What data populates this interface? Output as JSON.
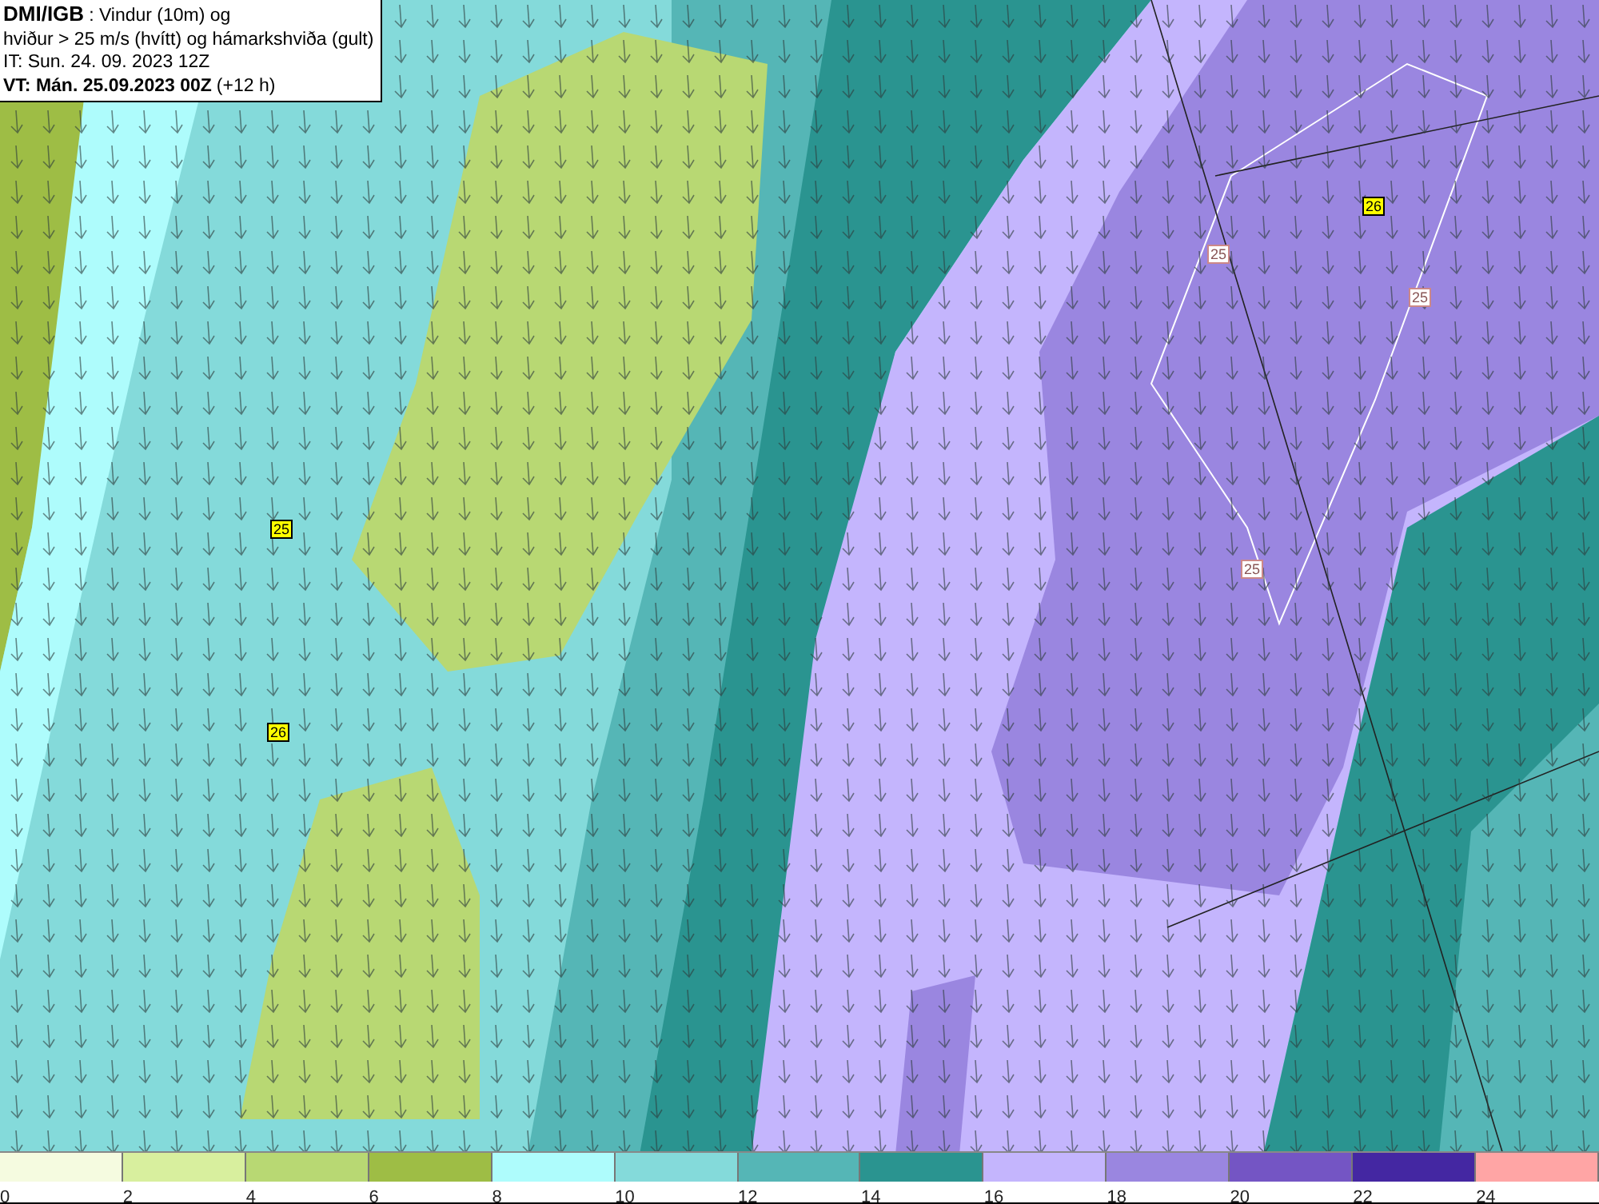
{
  "title_box": {
    "source": "DMI/IGB",
    "line_1": ": Vindur (10m) og",
    "line_2": "hviður > 25 m/s (hvítt) og hámarkshviða (gult)",
    "line_3": "IT: Sun. 24. 09. 2023 12Z",
    "valid_time": "VT: Mán. 25.09.2023 00Z",
    "lead": "(+12 h)"
  },
  "map": {
    "labels": [
      {
        "text": "26",
        "kind": "max"
      },
      {
        "text": "25",
        "kind": "gust"
      },
      {
        "text": "25",
        "kind": "gust"
      },
      {
        "text": "25",
        "kind": "gust"
      },
      {
        "text": "25",
        "kind": "max"
      },
      {
        "text": "26",
        "kind": "max"
      }
    ]
  },
  "legend": {
    "swatches": [
      {
        "color": "#f5fbe0"
      },
      {
        "color": "#d8ef9e"
      },
      {
        "color": "#b8d873"
      },
      {
        "color": "#9ebd45"
      },
      {
        "color": "#aefcfc"
      },
      {
        "color": "#84dada"
      },
      {
        "color": "#55b6b6"
      },
      {
        "color": "#2a9490"
      },
      {
        "color": "#c4b5fd"
      },
      {
        "color": "#9a86e0"
      },
      {
        "color": "#7455c4"
      },
      {
        "color": "#4427a2"
      },
      {
        "color": "#ffa5a5"
      }
    ],
    "ticks": [
      "0",
      "2",
      "4",
      "6",
      "8",
      "10",
      "12",
      "14",
      "16",
      "18",
      "20",
      "22",
      "24"
    ]
  }
}
